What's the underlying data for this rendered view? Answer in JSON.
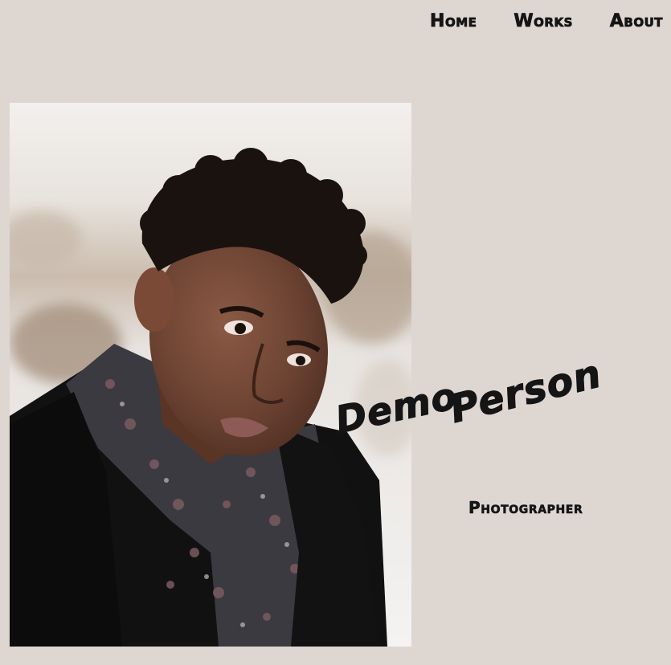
{
  "nav": {
    "items": [
      {
        "label": "Home"
      },
      {
        "label": "Works"
      },
      {
        "label": "About"
      }
    ]
  },
  "hero": {
    "name_first": "Demo",
    "name_last": "Person",
    "role": "Photographer"
  },
  "colors": {
    "background": "#ded6d1",
    "text": "#151515"
  }
}
